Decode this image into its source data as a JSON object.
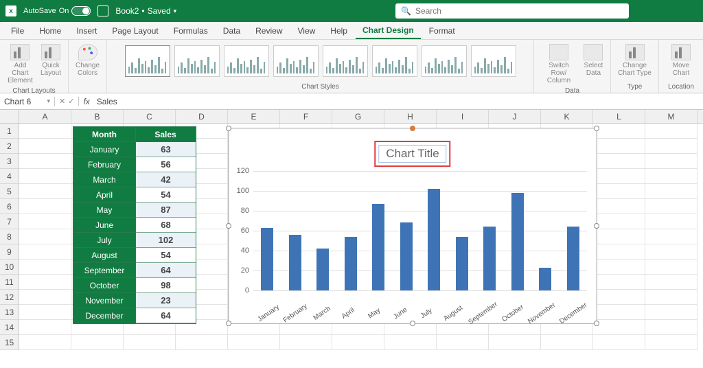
{
  "titlebar": {
    "autosave_label": "AutoSave",
    "autosave_state": "On",
    "doc_name": "Book2",
    "doc_status": "Saved"
  },
  "search": {
    "placeholder": "Search"
  },
  "menu": {
    "items": [
      "File",
      "Home",
      "Insert",
      "Page Layout",
      "Formulas",
      "Data",
      "Review",
      "View",
      "Help",
      "Chart Design",
      "Format"
    ],
    "active": "Chart Design"
  },
  "ribbon": {
    "layouts": {
      "add_element": "Add Chart\nElement",
      "quick_layout": "Quick\nLayout",
      "group": "Chart Layouts"
    },
    "colors": {
      "label": "Change\nColors"
    },
    "styles": {
      "group": "Chart Styles"
    },
    "data": {
      "switch": "Switch Row/\nColumn",
      "select": "Select\nData",
      "group": "Data"
    },
    "type": {
      "change": "Change\nChart Type",
      "group": "Type"
    },
    "location": {
      "move": "Move\nChart",
      "group": "Location"
    }
  },
  "formula_bar": {
    "name": "Chart 6",
    "value": "Sales"
  },
  "columns": [
    "A",
    "B",
    "C",
    "D",
    "E",
    "F",
    "G",
    "H",
    "I",
    "J",
    "K",
    "L",
    "M"
  ],
  "rows": 15,
  "table": {
    "headers": [
      "Month",
      "Sales"
    ],
    "rows": [
      [
        "January",
        63
      ],
      [
        "February",
        56
      ],
      [
        "March",
        42
      ],
      [
        "April",
        54
      ],
      [
        "May",
        87
      ],
      [
        "June",
        68
      ],
      [
        "July",
        102
      ],
      [
        "August",
        54
      ],
      [
        "September",
        64
      ],
      [
        "October",
        98
      ],
      [
        "November",
        23
      ],
      [
        "December",
        64
      ]
    ]
  },
  "chart_data": {
    "type": "bar",
    "title": "Chart Title",
    "categories": [
      "January",
      "February",
      "March",
      "April",
      "May",
      "June",
      "July",
      "August",
      "September",
      "October",
      "November",
      "December"
    ],
    "values": [
      63,
      56,
      42,
      54,
      87,
      68,
      102,
      54,
      64,
      98,
      23,
      64
    ],
    "xlabel": "",
    "ylabel": "",
    "ylim": [
      0,
      120
    ],
    "yticks": [
      0,
      20,
      40,
      60,
      80,
      100,
      120
    ]
  }
}
